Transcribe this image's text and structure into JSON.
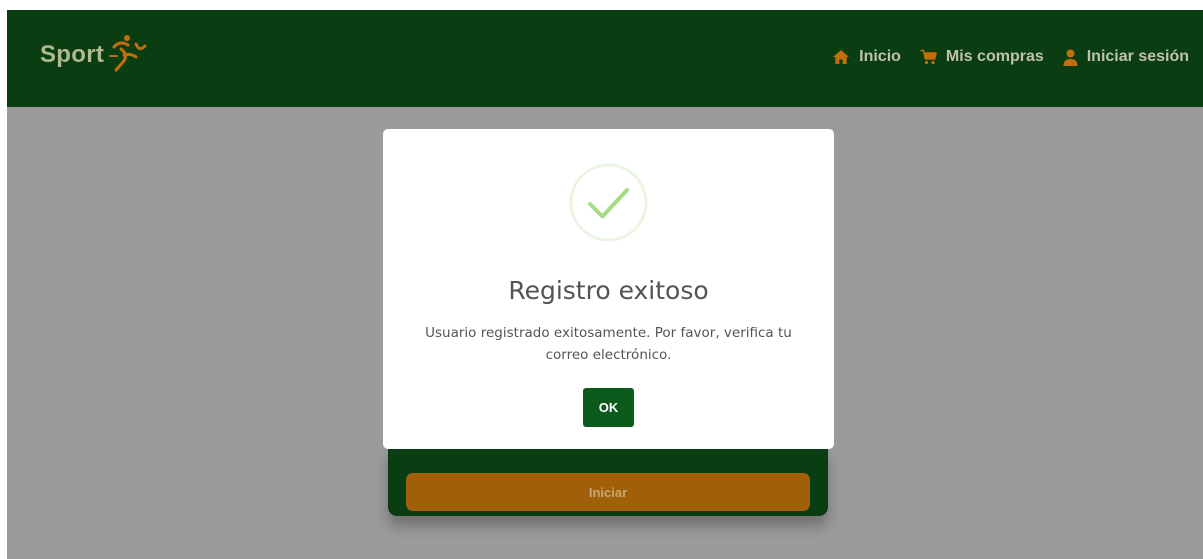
{
  "header": {
    "brand": "Sport",
    "logo_icon": "runner-logo-icon",
    "nav": [
      {
        "label": "Inicio",
        "icon": "home-icon"
      },
      {
        "label": "Mis compras",
        "icon": "cart-icon"
      },
      {
        "label": "Iniciar sesión",
        "icon": "user-icon"
      }
    ]
  },
  "form": {
    "submit_label": "Iniciar"
  },
  "modal": {
    "icon": "success-check-icon",
    "title": "Registro exitoso",
    "message": "Usuario registrado exitosamente. Por favor, verifica tu correo electrónico.",
    "ok_label": "OK"
  },
  "colors": {
    "navbar": "#0a3e12",
    "accent_orange": "#c26e0a",
    "button_orange": "#a0600a",
    "ok_green": "#0c5a1c",
    "success_green": "#a5dc86",
    "backdrop": "#9b9b9b"
  }
}
